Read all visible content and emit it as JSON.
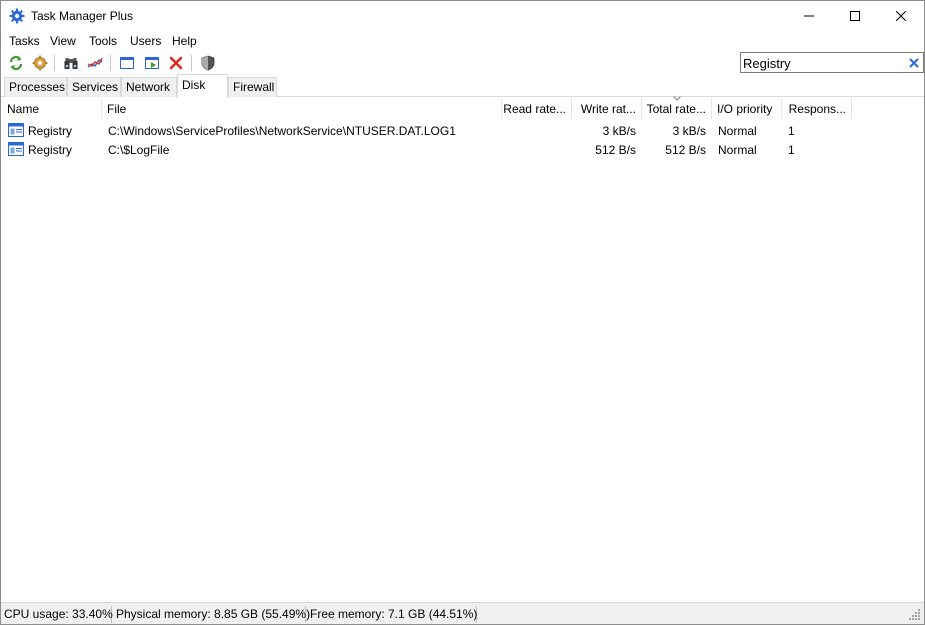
{
  "window": {
    "title": "Task Manager Plus"
  },
  "menu": {
    "items": [
      "Tasks",
      "View",
      "Tools",
      "Users",
      "Help"
    ]
  },
  "toolbar": {
    "buttons": [
      "refresh-icon",
      "settings-icon",
      "find-icon",
      "graph-icon",
      "window-icon",
      "run-icon",
      "terminate-icon",
      "shield-icon"
    ]
  },
  "search": {
    "value": "Registry",
    "clear_icon": "close-icon"
  },
  "tabs": [
    {
      "label": "Processes"
    },
    {
      "label": "Services"
    },
    {
      "label": "Network"
    },
    {
      "label": "Disk",
      "active": true
    },
    {
      "label": "Firewall"
    }
  ],
  "columns": [
    "Name",
    "File",
    "Read rate...",
    "Write rat...",
    "Total rate...",
    "I/O priority",
    "Respons..."
  ],
  "sorted_column": "Total rate...",
  "rows": [
    {
      "name": "Registry",
      "file": "C:\\Windows\\ServiceProfiles\\NetworkService\\NTUSER.DAT.LOG1",
      "read": "",
      "write": "3 kB/s",
      "total": "3 kB/s",
      "priority": "Normal",
      "response": "1"
    },
    {
      "name": "Registry",
      "file": "C:\\$LogFile",
      "read": "",
      "write": "512 B/s",
      "total": "512 B/s",
      "priority": "Normal",
      "response": "1"
    }
  ],
  "status": {
    "cpu": "CPU usage: 33.40%",
    "physical": "Physical memory: 8.85 GB (55.49%)",
    "free": "Free memory: 7.1 GB (44.51%)"
  },
  "colors": {
    "accent": "#2a66d9",
    "close_red": "#e0291f",
    "green": "#3a9a2c"
  }
}
